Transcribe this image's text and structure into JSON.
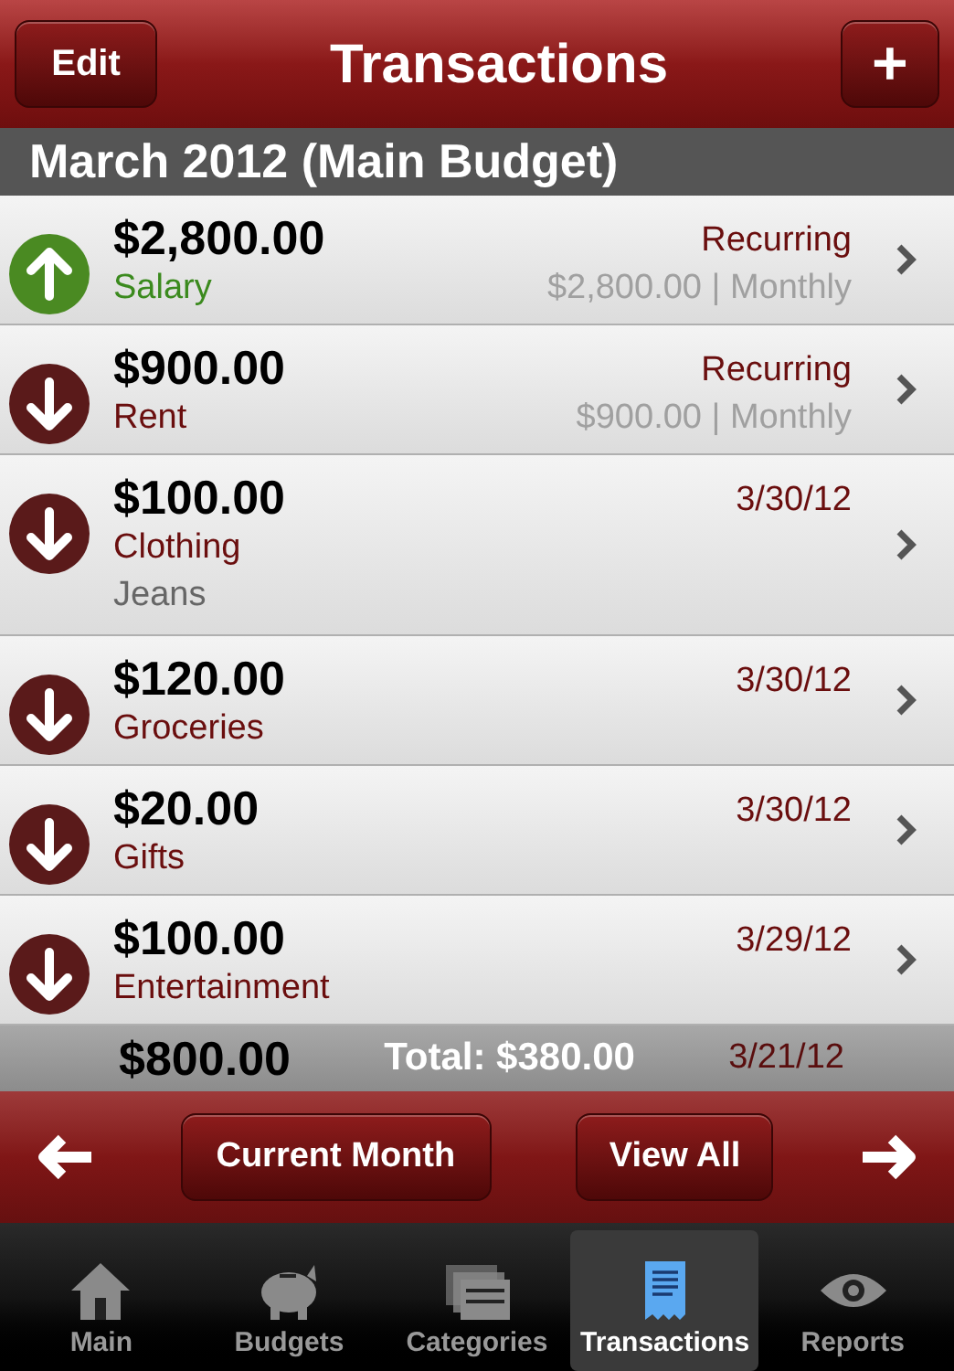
{
  "nav": {
    "edit": "Edit",
    "title": "Transactions",
    "add": "+"
  },
  "section": "March 2012 (Main Budget)",
  "rows": [
    {
      "kind": "income",
      "amount": "$2,800.00",
      "category": "Salary",
      "status": "Recurring",
      "detail": "$2,800.00 | Monthly"
    },
    {
      "kind": "expense",
      "amount": "$900.00",
      "category": "Rent",
      "status": "Recurring",
      "detail": "$900.00 | Monthly"
    },
    {
      "kind": "expense",
      "amount": "$100.00",
      "category": "Clothing",
      "note": "Jeans",
      "status": "3/30/12"
    },
    {
      "kind": "expense",
      "amount": "$120.00",
      "category": "Groceries",
      "status": "3/30/12"
    },
    {
      "kind": "expense",
      "amount": "$20.00",
      "category": "Gifts",
      "status": "3/30/12"
    },
    {
      "kind": "expense",
      "amount": "$100.00",
      "category": "Entertainment",
      "status": "3/29/12"
    }
  ],
  "partial_row": {
    "amount": "$800.00",
    "status": "3/21/12"
  },
  "total": "Total: $380.00",
  "toolbar": {
    "current": "Current Month",
    "all": "View All"
  },
  "tabs": [
    {
      "kind": "house",
      "label": "Main",
      "selected": false
    },
    {
      "kind": "piggy",
      "label": "Budgets",
      "selected": false
    },
    {
      "kind": "cards",
      "label": "Categories",
      "selected": false
    },
    {
      "kind": "receipt",
      "label": "Transactions",
      "selected": true
    },
    {
      "kind": "eye",
      "label": "Reports",
      "selected": false
    }
  ]
}
